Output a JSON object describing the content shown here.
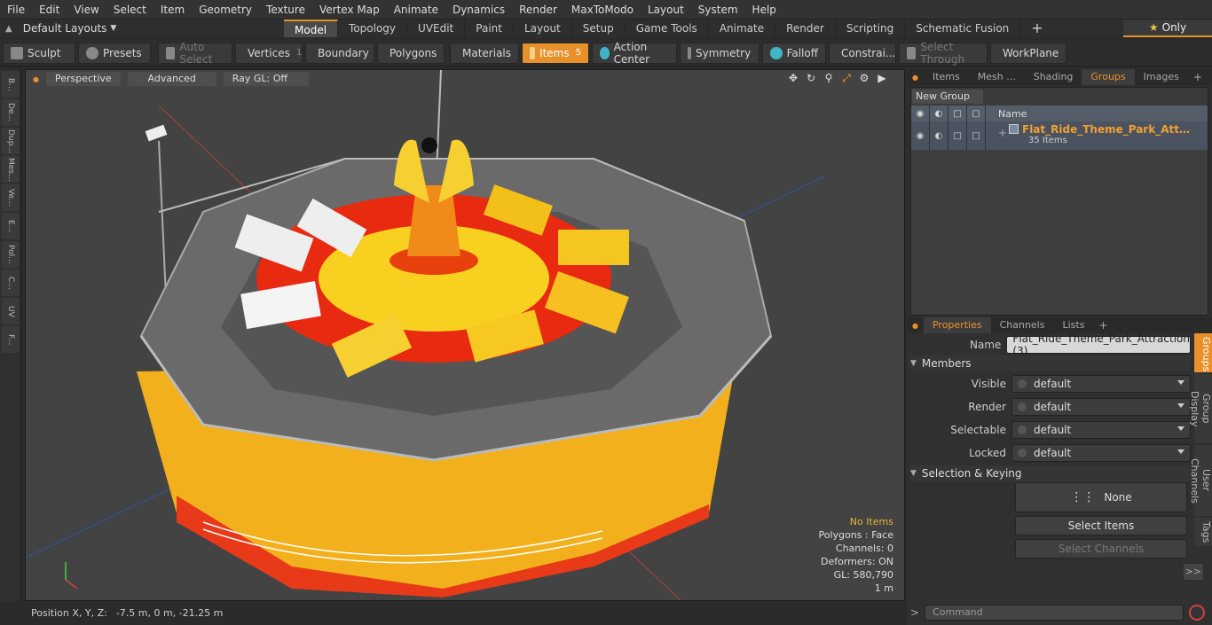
{
  "menu": [
    "File",
    "Edit",
    "View",
    "Select",
    "Item",
    "Geometry",
    "Texture",
    "Vertex Map",
    "Animate",
    "Dynamics",
    "Render",
    "MaxToModo",
    "Layout",
    "System",
    "Help"
  ],
  "layouts": {
    "label": "Default Layouts"
  },
  "tabs": [
    "Model",
    "Topology",
    "UVEdit",
    "Paint",
    "Layout",
    "Setup",
    "Game Tools",
    "Animate",
    "Render",
    "Scripting",
    "Schematic Fusion"
  ],
  "only_label": "Only",
  "toolbar": {
    "sculpt": "Sculpt",
    "presets": "Presets",
    "auto_select": "Auto Select",
    "vertices": "Vertices",
    "vertices_count": "1",
    "boundary": "Boundary",
    "polygons": "Polygons",
    "materials": "Materials",
    "items": "Items",
    "items_count": "5",
    "action_center": "Action Center",
    "symmetry": "Symmetry",
    "falloff": "Falloff",
    "constraints": "Constrai...",
    "select_through": "Select Through",
    "workplane": "WorkPlane"
  },
  "left_tabs": [
    "B...",
    "De...",
    "Dup...",
    "Mes...",
    "Ve...",
    "E...",
    "Pol...",
    "C...",
    "UV",
    "F..."
  ],
  "viewport": {
    "perspective": "Perspective",
    "advanced": "Advanced",
    "raygl": "Ray GL: Off"
  },
  "stats": {
    "no_items": "No Items",
    "polygons": "Polygons : Face",
    "channels": "Channels: 0",
    "deformers": "Deformers: ON",
    "gl": "GL: 580,790",
    "scale": "1 m"
  },
  "status": {
    "label": "Position X, Y, Z:",
    "value": "-7.5 m, 0 m, -21.25 m"
  },
  "panel_tabs": [
    "Items",
    "Mesh ...",
    "Shading",
    "Groups",
    "Images"
  ],
  "groups": {
    "new_group": "New Group",
    "name_col": "Name",
    "item_name": "Flat_Ride_Theme_Park_Attracti...",
    "item_count": "35 Items"
  },
  "props_tabs": [
    "Properties",
    "Channels",
    "Lists"
  ],
  "props": {
    "name_label": "Name",
    "name_value": "Flat_Ride_Theme_Park_Attraction (3)",
    "members": "Members",
    "visible_label": "Visible",
    "visible_value": "default",
    "render_label": "Render",
    "render_value": "default",
    "selectable_label": "Selectable",
    "selectable_value": "default",
    "locked_label": "Locked",
    "locked_value": "default",
    "sel_keying": "Selection & Keying",
    "none": "None",
    "select_items": "Select Items",
    "select_channels": "Select Channels",
    "more": ">>"
  },
  "side_vtabs": [
    "Groups",
    "Group Display",
    "User Channels",
    "Tags"
  ],
  "command": {
    "placeholder": "Command"
  }
}
